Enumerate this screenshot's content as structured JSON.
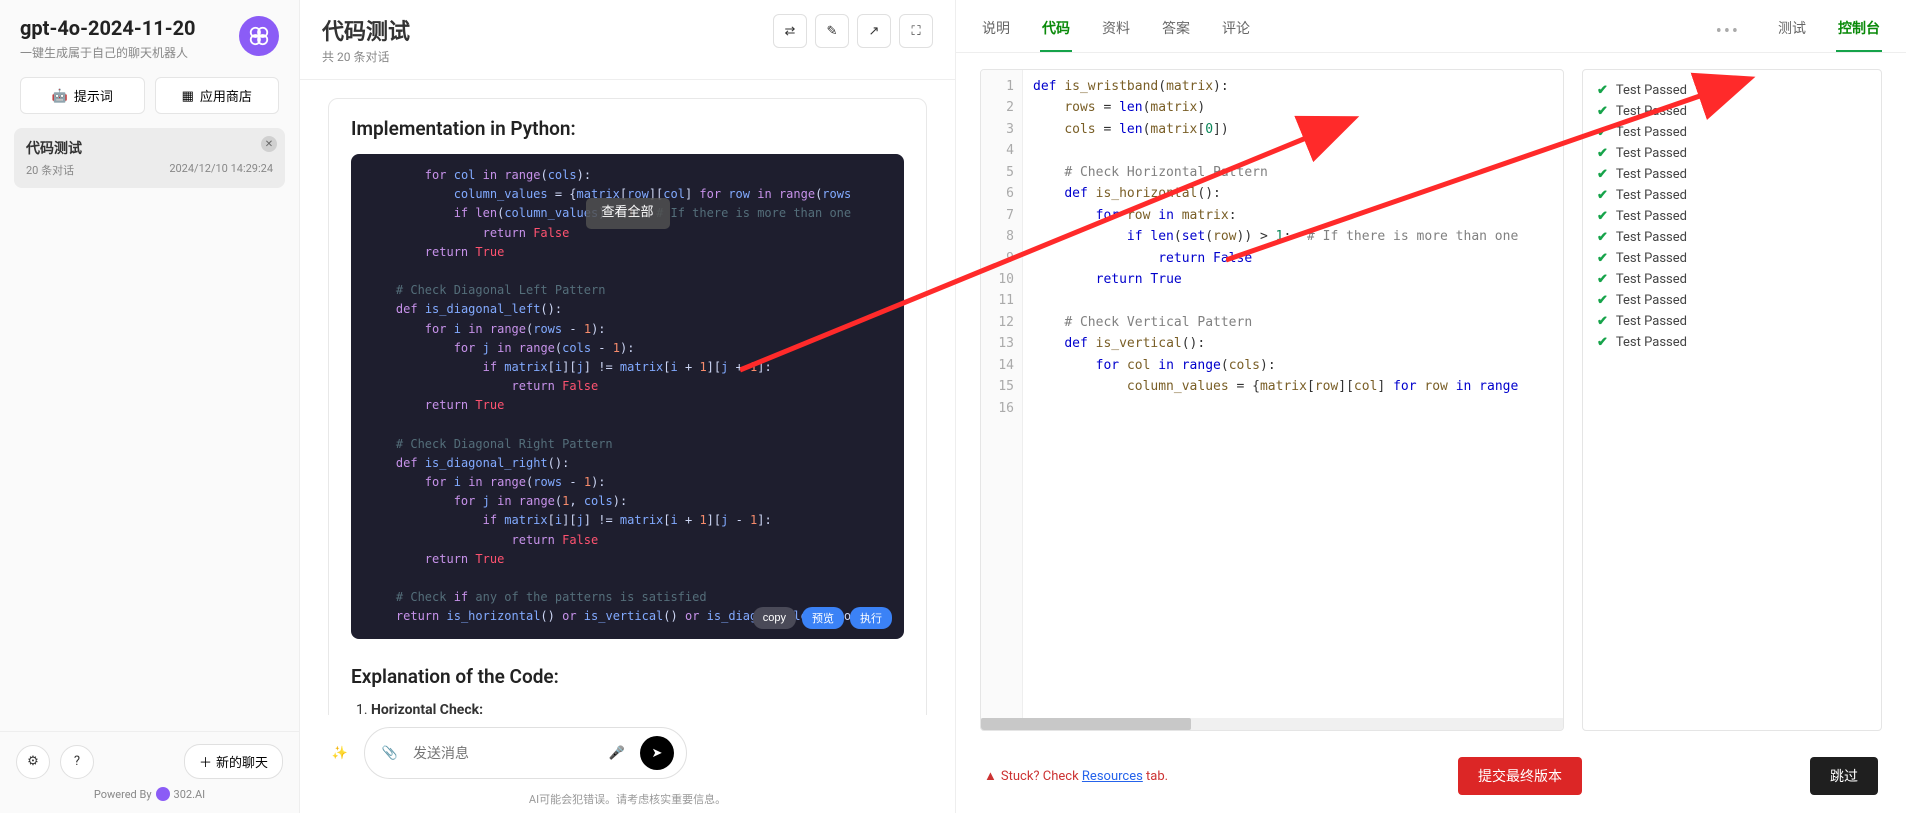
{
  "sidebar": {
    "model": "gpt-4o-2024-11-20",
    "subtitle": "一键生成属于自己的聊天机器人",
    "prompt_btn": "提示词",
    "store_btn": "应用商店",
    "conversation": {
      "title": "代码测试",
      "count": "20 条对话",
      "time": "2024/12/10 14:29:24"
    },
    "new_chat": "新的聊天",
    "powered": "Powered By",
    "brand": "302.AI"
  },
  "chat": {
    "title": "代码测试",
    "sub": "共 20 条对话",
    "section_impl": "Implementation in Python:",
    "view_all": "查看全部",
    "copy": "copy",
    "preview": "预览",
    "run": "执行",
    "section_expl": "Explanation of the Code:",
    "expl_item1": "Horizontal Check:",
    "input_placeholder": "发送消息",
    "disclaimer": "AI可能会犯错误。请考虑核实重要信息。"
  },
  "editor": {
    "tabs_left": [
      "说明",
      "代码",
      "资料",
      "答案",
      "评论"
    ],
    "tabs_left_active": 1,
    "tabs_right": [
      "测试",
      "控制台"
    ],
    "tabs_right_active": 1,
    "stuck_prefix": "Stuck? Check ",
    "stuck_link": "Resources",
    "stuck_suffix": " tab.",
    "submit": "提交最终版本",
    "skip": "跳过",
    "code_lines": [
      "def is_wristband(matrix):",
      "    rows = len(matrix)",
      "    cols = len(matrix[0])",
      "",
      "    # Check Horizontal Pattern",
      "    def is_horizontal():",
      "        for row in matrix:",
      "            if len(set(row)) > 1:  # If there is more than one",
      "                return False",
      "        return True",
      "",
      "    # Check Vertical Pattern",
      "    def is_vertical():",
      "        for col in range(cols):",
      "            column_values = {matrix[row][col] for row in range",
      ""
    ],
    "results": [
      "Test Passed",
      "Test Passed",
      "Test Passed",
      "Test Passed",
      "Test Passed",
      "Test Passed",
      "Test Passed",
      "Test Passed",
      "Test Passed",
      "Test Passed",
      "Test Passed",
      "Test Passed",
      "Test Passed"
    ]
  },
  "left_code": [
    "        for col in range(cols):",
    "            column_values = {matrix[row][col] for row in range(rows",
    "            if len(column_values) > 1:  # If there is more than one",
    "                return False",
    "        return True",
    "",
    "    # Check Diagonal Left Pattern",
    "    def is_diagonal_left():",
    "        for i in range(rows - 1):",
    "            for j in range(cols - 1):",
    "                if matrix[i][j] != matrix[i + 1][j + 1]:",
    "                    return False",
    "        return True",
    "",
    "    # Check Diagonal Right Pattern",
    "    def is_diagonal_right():",
    "        for i in range(rows - 1):",
    "            for j in range(1, cols):",
    "                if matrix[i][j] != matrix[i + 1][j - 1]:",
    "                    return False",
    "        return True",
    "",
    "    # Check if any of the patterns is satisfied",
    "    return is_horizontal() or is_vertical() or is_diagonal_left() o"
  ]
}
